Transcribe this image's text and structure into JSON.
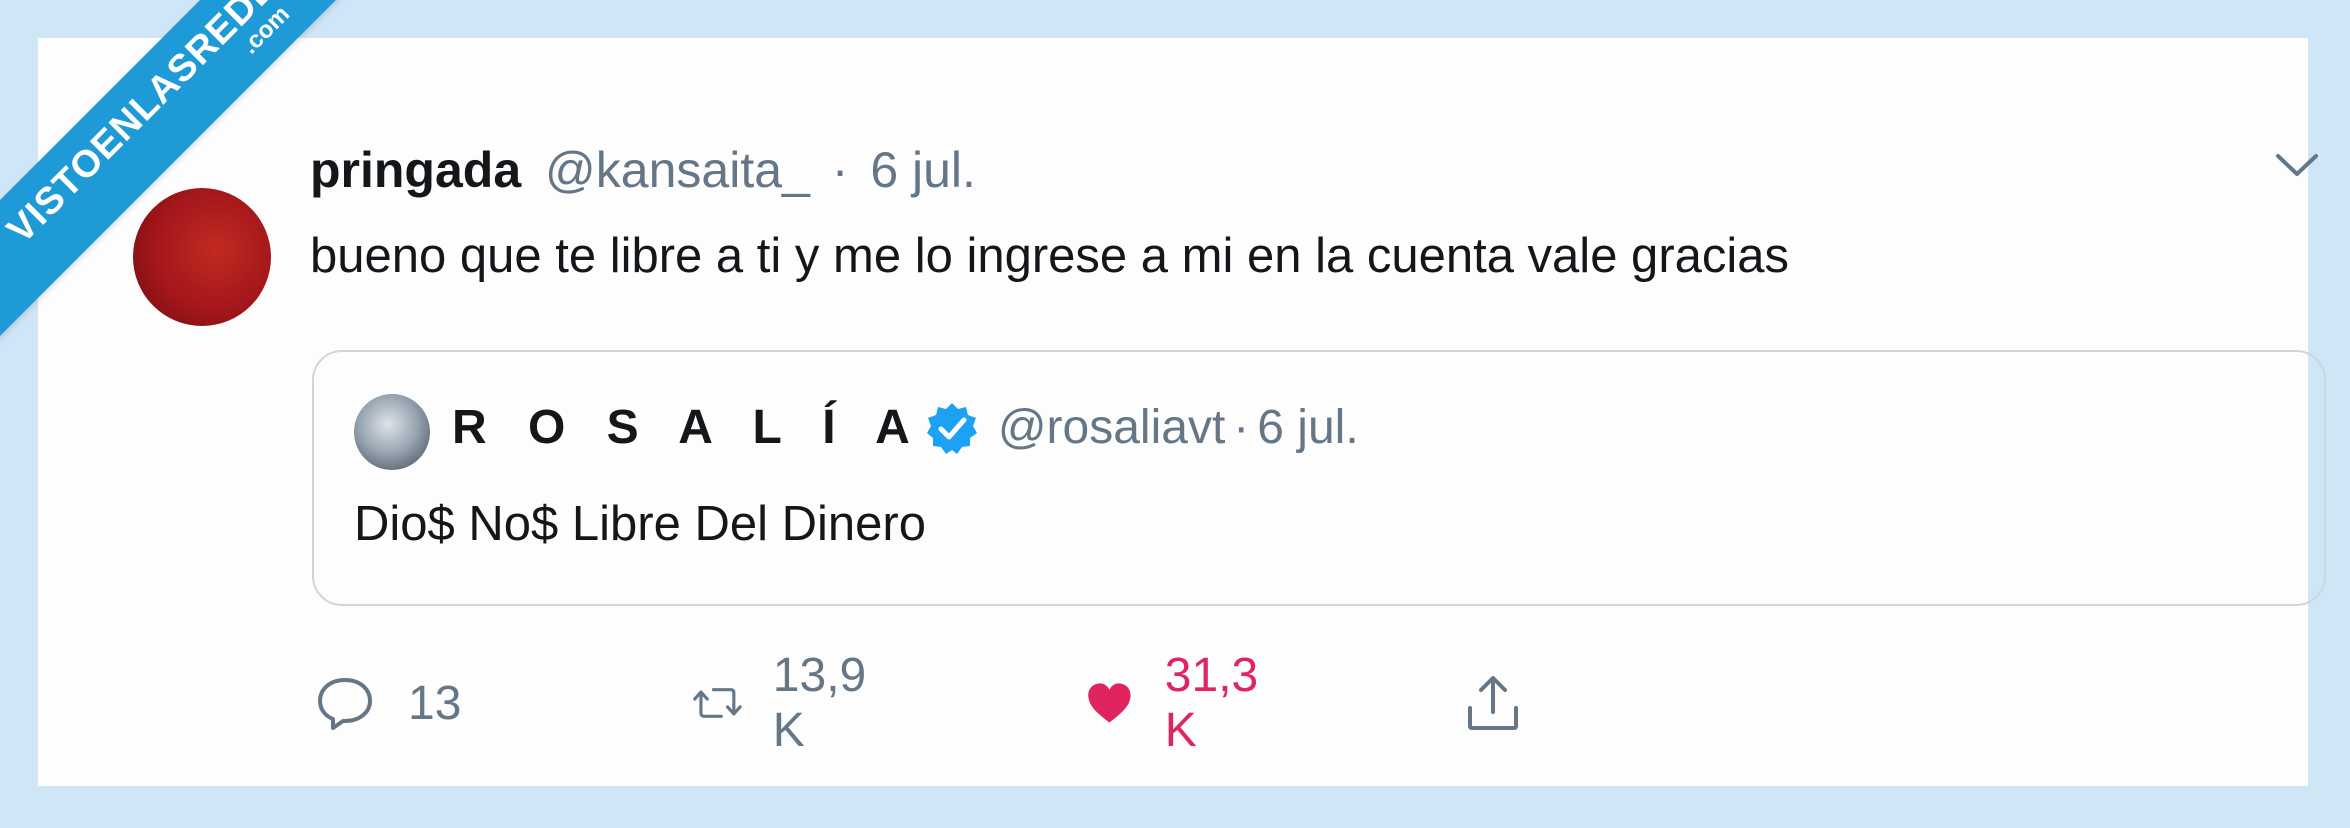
{
  "watermark": {
    "line1": "VISTOENLASREDES",
    "line2": ".com"
  },
  "tweet": {
    "display_name": "pringada",
    "handle": "@kansaita_",
    "separator": "·",
    "date": "6 jul.",
    "text": "bueno que te libre a ti y me lo ingrese a mi en la cuenta vale gracias",
    "menu_icon": "chevron-down-icon"
  },
  "quoted_tweet": {
    "display_name": "R O S A L Í A",
    "verified": true,
    "handle": "@rosaliavt",
    "separator": "·",
    "date": "6 jul.",
    "text": "Dio$ No$ Libre Del Dinero"
  },
  "actions": {
    "reply_count": "13",
    "retweet_count": "13,9 K",
    "like_count": "31,3 K",
    "liked": true,
    "icons": [
      "reply-icon",
      "retweet-icon",
      "heart-icon",
      "share-icon"
    ]
  },
  "colors": {
    "background": "#cfe6f6",
    "card": "#fdfdfe",
    "muted": "#657786",
    "like": "#e0245e",
    "verified": "#1da1f2",
    "badge": "#1e9ad6"
  }
}
